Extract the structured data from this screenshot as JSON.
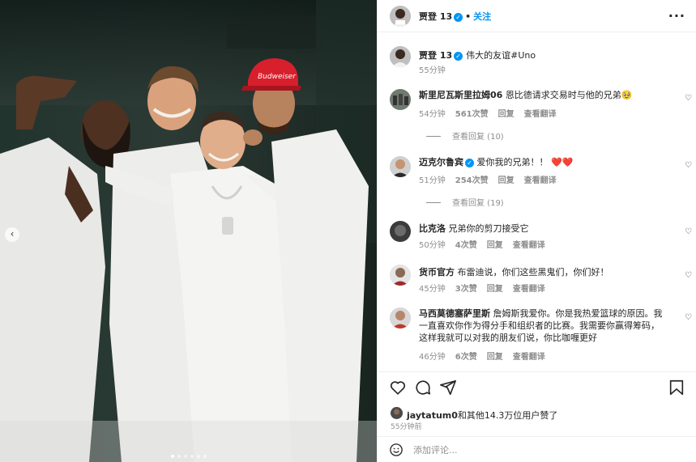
{
  "post_author": {
    "name": "贾登 13",
    "separator": "•",
    "follow_label": "关注",
    "more_icon": "more-horizontal-icon"
  },
  "caption": {
    "name": "贾登 13",
    "text": "伟大的友谊#Uno",
    "time": "55分钟"
  },
  "comments": [
    {
      "user": "斯里尼瓦斯里拉姆06",
      "text": "恩比德请求交易时与他的兄弟🥹",
      "time": "54分钟",
      "likes": "561次赞",
      "reply": "回复",
      "translate": "查看翻译",
      "replies": "查看回复 (10)"
    },
    {
      "user": "迈克尔鲁宾",
      "text": "爱你我的兄弟！！",
      "hearts": "❤️❤️",
      "verified": true,
      "time": "51分钟",
      "likes": "254次赞",
      "reply": "回复",
      "translate": "查看翻译",
      "replies": "查看回复 (19)"
    },
    {
      "user": "比克洛",
      "text": "兄弟你的剪刀接受它",
      "time": "50分钟",
      "likes": "4次赞",
      "reply": "回复",
      "translate": "查看翻译"
    },
    {
      "user": "货币官方",
      "text": "布雷迪说，你们这些黑鬼们，你们好！",
      "time": "45分钟",
      "likes": "3次赞",
      "reply": "回复",
      "translate": "查看翻译"
    },
    {
      "user": "马西莫德塞萨里斯",
      "text_lines": [
        "詹姆斯我爱你。你是我热爱篮球的原因。我",
        "一直喜欢你作为得分手和组织者的比赛。我需要你赢得筹码，",
        "这样我就可以对我的朋友们说，你比咖喱更好"
      ],
      "time": "46分钟",
      "likes": "6次赞",
      "reply": "回复",
      "translate": "查看翻译"
    }
  ],
  "actions": {
    "like_icon": "heart-icon",
    "comment_icon": "comment-icon",
    "share_icon": "share-icon",
    "save_icon": "bookmark-icon"
  },
  "likes": {
    "user": "jaytatum0",
    "text": "和其他14.3万位用户赞了"
  },
  "time_ago": "55分钟前",
  "comment_input": {
    "placeholder": "添加评论...",
    "value": ""
  },
  "carousel": {
    "prev_icon": "chevron-left-icon",
    "count": 6,
    "active": 0
  },
  "colors": {
    "accent": "#0095f6",
    "heart_red": "#ed4956",
    "muted": "#8e8e8e"
  }
}
